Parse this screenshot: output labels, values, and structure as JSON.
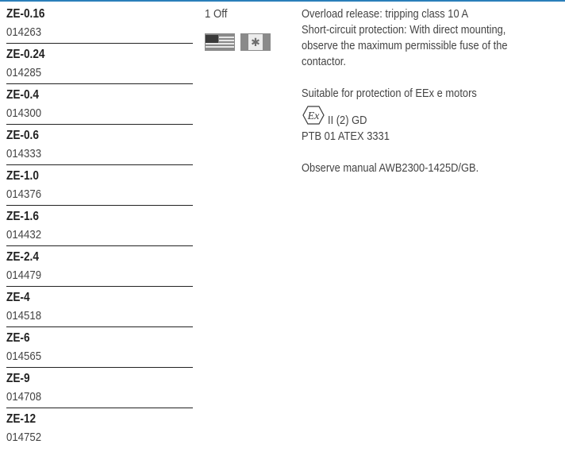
{
  "products": [
    {
      "name": "ZE-0.16",
      "code": "014263"
    },
    {
      "name": "ZE-0.24",
      "code": "014285"
    },
    {
      "name": "ZE-0.4",
      "code": "014300"
    },
    {
      "name": "ZE-0.6",
      "code": "014333"
    },
    {
      "name": "ZE-1.0",
      "code": "014376"
    },
    {
      "name": "ZE-1.6",
      "code": "014432"
    },
    {
      "name": "ZE-2.4",
      "code": "014479"
    },
    {
      "name": "ZE-4",
      "code": "014518"
    },
    {
      "name": "ZE-6",
      "code": "014565"
    },
    {
      "name": "ZE-9",
      "code": "014708"
    },
    {
      "name": "ZE-12",
      "code": "014752"
    }
  ],
  "quantity": "1 Off",
  "icons": {
    "flag_us": "us-flag-icon",
    "flag_ca": "canada-flag-icon",
    "ex": "ex-marking-icon"
  },
  "description": {
    "line1": "Overload release: tripping class 10 A",
    "line2": "Short-circuit protection: With direct mounting,",
    "line3": "observe the maximum permissible fuse of the",
    "line4": "contactor.",
    "line5": "Suitable for protection of EEx e motors",
    "ex_symbol": "Ex",
    "ex_text": "II (2) GD",
    "line6": "PTB 01 ATEX 3331",
    "line7": "Observe manual AWB2300-1425D/GB."
  },
  "colors": {
    "accent_line": "#2a7fba"
  }
}
